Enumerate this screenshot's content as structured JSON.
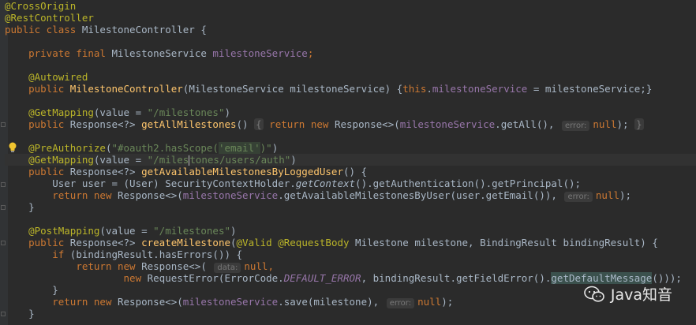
{
  "editor": {
    "l1_ann1": "@CrossOrigin",
    "l2_ann2": "@RestController",
    "l3_kw": "public class",
    "l3_rest": " MilestoneController {",
    "l5_kw": "private final",
    "l5_type": " MilestoneService ",
    "l5_field": "milestoneService",
    "l5_end": ";",
    "l7_ann": "@Autowired",
    "l8_kw": "public",
    "l8_fn": "MilestoneController",
    "l8_params": "(MilestoneService milestoneService) {",
    "l8_this": "this",
    "l8_dot": ".",
    "l8_field": "milestoneService",
    "l8_end": " = milestoneService;}",
    "l10_ann": "@GetMapping",
    "l10_paren": "(value = ",
    "l10_str": "\"/milestones\"",
    "l10_close": ")",
    "l11_kw": "public",
    "l11_type": " Response<?> ",
    "l11_fn": "getAllMilestones",
    "l11_paren": "() ",
    "l11_brace": "{",
    "l11_ret": "return new",
    "l11_resp": " Response<>(",
    "l11_field": "milestoneService",
    "l11_call": ".getAll(),",
    "l11_hint": "error:",
    "l11_null": "null",
    "l11_end": ");",
    "l11_close": "}",
    "l13_ann": "@PreAuthorize",
    "l13_open": "(",
    "l13_str1": "\"#oauth2.hasScope(",
    "l13_str2": "'email'",
    "l13_str3": ")\"",
    "l13_close": ")",
    "l14_ann": "@GetMapping",
    "l14_paren": "(value = ",
    "l14_str_a": "\"/miles",
    "l14_str_b": "tones/users/auth\"",
    "l14_close": ")",
    "l15_kw": "public",
    "l15_type": " Response<?> ",
    "l15_fn": "getAvailableMilestonesByLoggedUser",
    "l15_end": "() {",
    "l16_text1": "User user = (User) SecurityContextHolder.",
    "l16_it": "getContext",
    "l16_text2": "().getAuthentication().getPrincipal();",
    "l17_ret": "return new",
    "l17_resp": " Response<>(",
    "l17_field": "milestoneService",
    "l17_call": ".getAvailableMilestonesByUser(user.getEmail()),",
    "l17_hint": "error:",
    "l17_null": "null",
    "l17_end": ");",
    "l18_close": "}",
    "l20_ann": "@PostMapping",
    "l20_paren": "(value = ",
    "l20_str": "\"/milestones\"",
    "l20_close": ")",
    "l21_kw": "public",
    "l21_type": " Response<?> ",
    "l21_fn": "createMilestone",
    "l21_open": "(",
    "l21_ann1": "@Valid",
    "l21_ann2": "@RequestBody",
    "l21_rest": " Milestone milestone, BindingResult bindingResult) {",
    "l22_kw": "if",
    "l22_rest": " (bindingResult.hasErrors()) {",
    "l23_ret": "return new",
    "l23_resp": " Response<>(",
    "l23_hint": "data:",
    "l23_null": "null",
    "l23_comma": ",",
    "l24_kw": "new",
    "l24_text1": " RequestError(ErrorCode.",
    "l24_stat": "DEFAULT_ERROR",
    "l24_text2": ", bindingResult.getFieldError().",
    "l24_hl": "getDefaultMessage",
    "l24_end": "()));",
    "l25_close": "}",
    "l26_ret": "return new",
    "l26_resp": " Response<>(",
    "l26_field": "milestoneService",
    "l26_call": ".save(milestone),",
    "l26_hint": "error:",
    "l26_null": "null",
    "l26_end": ");",
    "l27_close": "}"
  },
  "watermark": {
    "label": "Java知音",
    "icon": "wechat-icon"
  },
  "colors": {
    "background": "#2b2b2b",
    "annotation": "#bbb529",
    "keyword": "#cc7832",
    "function": "#ffc66d",
    "field": "#9876aa",
    "string": "#6a8759",
    "text": "#a9b7c6"
  }
}
